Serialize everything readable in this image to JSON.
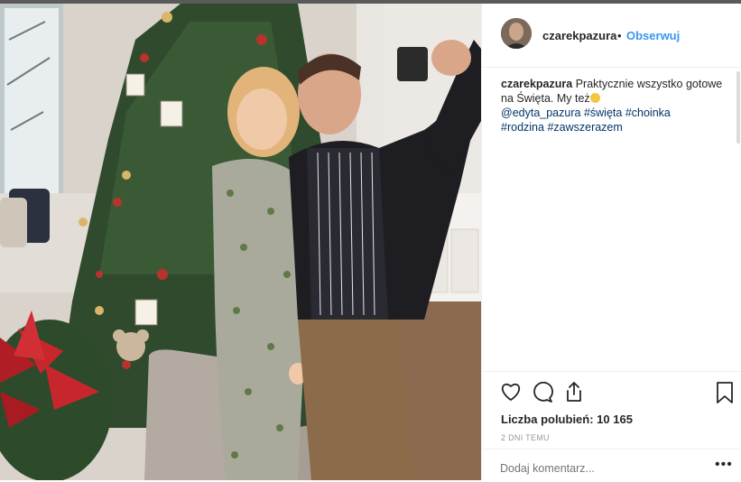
{
  "post": {
    "image_alt": "Couple taking a selfie next to a decorated Christmas tree",
    "username": "czarekpazura",
    "separator": "•",
    "follow_label": "Obserwuj",
    "caption": {
      "username": "czarekpazura",
      "text": "Praktycznie wszystko gotowe na Święta. My też",
      "emoji": "slightly-smiling-face",
      "mention": "@edyta_pazura",
      "hashtags": [
        "#święta",
        "#choinka",
        "#rodzina",
        "#zawszerazem"
      ]
    },
    "actions": {
      "like": "heart-icon",
      "comment": "comment-icon",
      "share": "share-icon",
      "save": "bookmark-icon"
    },
    "likes_text": "Liczba polubień: 10 165",
    "timestamp": "2 DNI TEMU",
    "comment_placeholder": "Dodaj komentarz...",
    "more_label": "•••"
  },
  "colors": {
    "link": "#3897f0",
    "tag": "#003569",
    "border": "#efefef",
    "muted": "#999999",
    "text": "#262626"
  }
}
